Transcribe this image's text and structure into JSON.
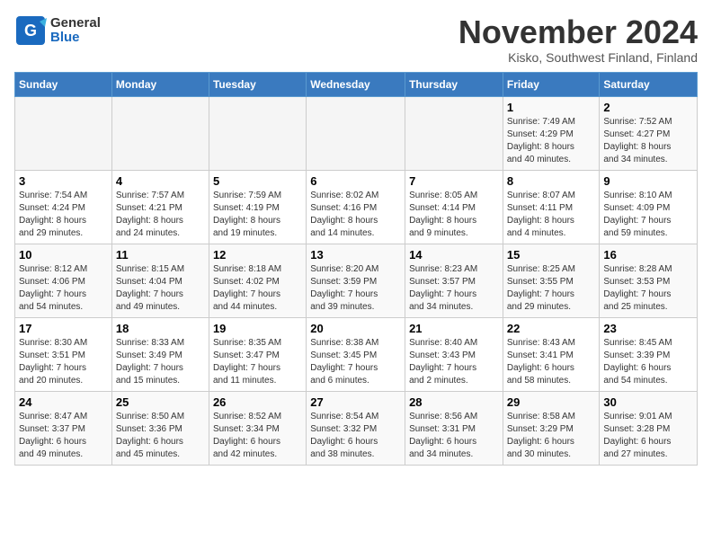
{
  "header": {
    "logo_line1": "General",
    "logo_line2": "Blue",
    "month_title": "November 2024",
    "subtitle": "Kisko, Southwest Finland, Finland"
  },
  "weekdays": [
    "Sunday",
    "Monday",
    "Tuesday",
    "Wednesday",
    "Thursday",
    "Friday",
    "Saturday"
  ],
  "weeks": [
    [
      {
        "day": "",
        "info": ""
      },
      {
        "day": "",
        "info": ""
      },
      {
        "day": "",
        "info": ""
      },
      {
        "day": "",
        "info": ""
      },
      {
        "day": "",
        "info": ""
      },
      {
        "day": "1",
        "info": "Sunrise: 7:49 AM\nSunset: 4:29 PM\nDaylight: 8 hours\nand 40 minutes."
      },
      {
        "day": "2",
        "info": "Sunrise: 7:52 AM\nSunset: 4:27 PM\nDaylight: 8 hours\nand 34 minutes."
      }
    ],
    [
      {
        "day": "3",
        "info": "Sunrise: 7:54 AM\nSunset: 4:24 PM\nDaylight: 8 hours\nand 29 minutes."
      },
      {
        "day": "4",
        "info": "Sunrise: 7:57 AM\nSunset: 4:21 PM\nDaylight: 8 hours\nand 24 minutes."
      },
      {
        "day": "5",
        "info": "Sunrise: 7:59 AM\nSunset: 4:19 PM\nDaylight: 8 hours\nand 19 minutes."
      },
      {
        "day": "6",
        "info": "Sunrise: 8:02 AM\nSunset: 4:16 PM\nDaylight: 8 hours\nand 14 minutes."
      },
      {
        "day": "7",
        "info": "Sunrise: 8:05 AM\nSunset: 4:14 PM\nDaylight: 8 hours\nand 9 minutes."
      },
      {
        "day": "8",
        "info": "Sunrise: 8:07 AM\nSunset: 4:11 PM\nDaylight: 8 hours\nand 4 minutes."
      },
      {
        "day": "9",
        "info": "Sunrise: 8:10 AM\nSunset: 4:09 PM\nDaylight: 7 hours\nand 59 minutes."
      }
    ],
    [
      {
        "day": "10",
        "info": "Sunrise: 8:12 AM\nSunset: 4:06 PM\nDaylight: 7 hours\nand 54 minutes."
      },
      {
        "day": "11",
        "info": "Sunrise: 8:15 AM\nSunset: 4:04 PM\nDaylight: 7 hours\nand 49 minutes."
      },
      {
        "day": "12",
        "info": "Sunrise: 8:18 AM\nSunset: 4:02 PM\nDaylight: 7 hours\nand 44 minutes."
      },
      {
        "day": "13",
        "info": "Sunrise: 8:20 AM\nSunset: 3:59 PM\nDaylight: 7 hours\nand 39 minutes."
      },
      {
        "day": "14",
        "info": "Sunrise: 8:23 AM\nSunset: 3:57 PM\nDaylight: 7 hours\nand 34 minutes."
      },
      {
        "day": "15",
        "info": "Sunrise: 8:25 AM\nSunset: 3:55 PM\nDaylight: 7 hours\nand 29 minutes."
      },
      {
        "day": "16",
        "info": "Sunrise: 8:28 AM\nSunset: 3:53 PM\nDaylight: 7 hours\nand 25 minutes."
      }
    ],
    [
      {
        "day": "17",
        "info": "Sunrise: 8:30 AM\nSunset: 3:51 PM\nDaylight: 7 hours\nand 20 minutes."
      },
      {
        "day": "18",
        "info": "Sunrise: 8:33 AM\nSunset: 3:49 PM\nDaylight: 7 hours\nand 15 minutes."
      },
      {
        "day": "19",
        "info": "Sunrise: 8:35 AM\nSunset: 3:47 PM\nDaylight: 7 hours\nand 11 minutes."
      },
      {
        "day": "20",
        "info": "Sunrise: 8:38 AM\nSunset: 3:45 PM\nDaylight: 7 hours\nand 6 minutes."
      },
      {
        "day": "21",
        "info": "Sunrise: 8:40 AM\nSunset: 3:43 PM\nDaylight: 7 hours\nand 2 minutes."
      },
      {
        "day": "22",
        "info": "Sunrise: 8:43 AM\nSunset: 3:41 PM\nDaylight: 6 hours\nand 58 minutes."
      },
      {
        "day": "23",
        "info": "Sunrise: 8:45 AM\nSunset: 3:39 PM\nDaylight: 6 hours\nand 54 minutes."
      }
    ],
    [
      {
        "day": "24",
        "info": "Sunrise: 8:47 AM\nSunset: 3:37 PM\nDaylight: 6 hours\nand 49 minutes."
      },
      {
        "day": "25",
        "info": "Sunrise: 8:50 AM\nSunset: 3:36 PM\nDaylight: 6 hours\nand 45 minutes."
      },
      {
        "day": "26",
        "info": "Sunrise: 8:52 AM\nSunset: 3:34 PM\nDaylight: 6 hours\nand 42 minutes."
      },
      {
        "day": "27",
        "info": "Sunrise: 8:54 AM\nSunset: 3:32 PM\nDaylight: 6 hours\nand 38 minutes."
      },
      {
        "day": "28",
        "info": "Sunrise: 8:56 AM\nSunset: 3:31 PM\nDaylight: 6 hours\nand 34 minutes."
      },
      {
        "day": "29",
        "info": "Sunrise: 8:58 AM\nSunset: 3:29 PM\nDaylight: 6 hours\nand 30 minutes."
      },
      {
        "day": "30",
        "info": "Sunrise: 9:01 AM\nSunset: 3:28 PM\nDaylight: 6 hours\nand 27 minutes."
      }
    ]
  ]
}
